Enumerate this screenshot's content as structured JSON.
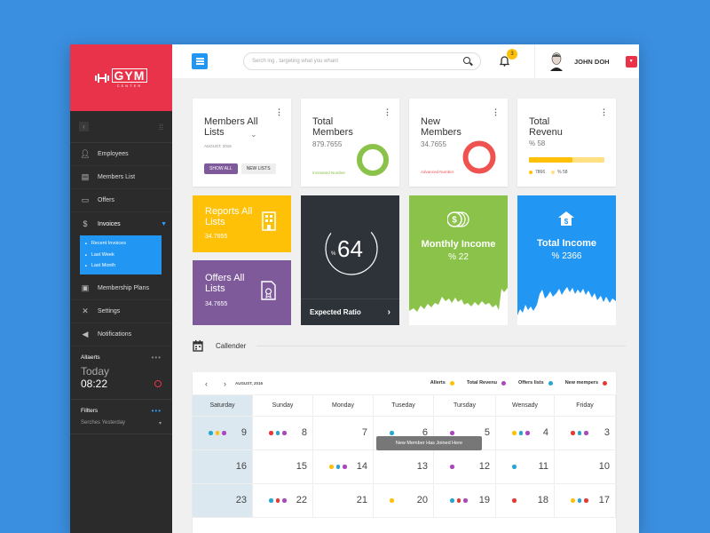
{
  "app": {
    "logo": "GYM",
    "logo_sub": "CENTER"
  },
  "sidebar": {
    "items": [
      {
        "label": "Employees",
        "icon": "user-icon"
      },
      {
        "label": "Members List",
        "icon": "users-icon"
      },
      {
        "label": "Offers",
        "icon": "monitor-icon"
      },
      {
        "label": "Invoices",
        "icon": "dollar-icon"
      },
      {
        "label": "Membership Plans",
        "icon": "card-icon"
      },
      {
        "label": "Settings",
        "icon": "tools-icon"
      },
      {
        "label": "Notifications",
        "icon": "megaphone-icon"
      }
    ],
    "submenu": [
      "Recent Invoices",
      "Last Week",
      "Last Month"
    ],
    "alerts": {
      "title": "Allaerts",
      "today": "Today",
      "time": "08:22"
    },
    "filters": {
      "title": "Fillters",
      "select": "Serches Yesterday"
    }
  },
  "topbar": {
    "search_placeholder": "Serch ing , targeting what you whant",
    "notif_count": "3",
    "user_name": "JOHN DOH"
  },
  "cards": {
    "members": {
      "title": "Members All Lists",
      "date": "AUGUST, 2016",
      "btn_all": "SHOW ALL",
      "btn_new": "NEW LISTS"
    },
    "total_members": {
      "title": "Total Members",
      "value": "879.7655",
      "note": "Increased Number",
      "ring_color": "#8bc34a"
    },
    "new_members": {
      "title": "New Members",
      "value": "34.7655",
      "note": "Advanced Number",
      "ring_color": "#ef5350"
    },
    "total_revenu": {
      "title": "Total Revenu",
      "value": "% 58",
      "legend1": "7866",
      "legend2": "% 58",
      "progress": 0.58
    }
  },
  "tiles": {
    "reports": {
      "title": "Reports All Lists",
      "value": "34.7655",
      "color": "#ffc107"
    },
    "offers": {
      "title": "Offers All Lists",
      "value": "34.7655",
      "color": "#7e5a9b"
    },
    "expected": {
      "value": "64",
      "percent": "%",
      "label": "Expected Ratio",
      "color": "#2d3339"
    },
    "monthly": {
      "title": "Monthly Income",
      "value": "% 22",
      "color": "#8bc34a"
    },
    "total_income": {
      "title": "Total Income",
      "value": "% 2366",
      "color": "#2196f3"
    }
  },
  "calendar": {
    "title": "Callender",
    "month": "AUGUST, 2016",
    "legend": [
      {
        "label": "Allerts",
        "color": "#ffc107"
      },
      {
        "label": "Total Revenu",
        "color": "#ab47bc"
      },
      {
        "label": "Offers lists",
        "color": "#26a6d1"
      },
      {
        "label": "New mempers",
        "color": "#e53935"
      }
    ],
    "days": [
      "Saturday",
      "Sunday",
      "Monday",
      "Tuseday",
      "Tursday",
      "Wensady",
      "Friday"
    ],
    "tooltip": "New Member Has Joined Here",
    "weeks": [
      [
        {
          "n": "9",
          "d": [
            "#26a6d1",
            "#ffc107",
            "#ab47bc"
          ]
        },
        {
          "n": "8",
          "d": [
            "#e53935",
            "#26a6d1",
            "#ab47bc"
          ]
        },
        {
          "n": "7",
          "d": []
        },
        {
          "n": "6",
          "d": [
            "#26a6d1"
          ]
        },
        {
          "n": "5",
          "d": [
            "#ab47bc"
          ]
        },
        {
          "n": "4",
          "d": [
            "#ffc107",
            "#26a6d1",
            "#ab47bc"
          ]
        },
        {
          "n": "3",
          "d": [
            "#e53935",
            "#26a6d1",
            "#ab47bc"
          ]
        }
      ],
      [
        {
          "n": "16",
          "d": []
        },
        {
          "n": "15",
          "d": []
        },
        {
          "n": "14",
          "d": [
            "#ffc107",
            "#26a6d1",
            "#ab47bc"
          ]
        },
        {
          "n": "13",
          "d": []
        },
        {
          "n": "12",
          "d": [
            "#ab47bc"
          ]
        },
        {
          "n": "11",
          "d": [
            "#26a6d1"
          ]
        },
        {
          "n": "10",
          "d": []
        }
      ],
      [
        {
          "n": "23",
          "d": []
        },
        {
          "n": "22",
          "d": [
            "#26a6d1",
            "#e53935",
            "#ab47bc"
          ]
        },
        {
          "n": "21",
          "d": []
        },
        {
          "n": "20",
          "d": [
            "#ffc107"
          ]
        },
        {
          "n": "19",
          "d": [
            "#26a6d1",
            "#e53935",
            "#ab47bc"
          ]
        },
        {
          "n": "18",
          "d": [
            "#e53935"
          ]
        },
        {
          "n": "17",
          "d": [
            "#ffc107",
            "#26a6d1",
            "#e53935"
          ]
        }
      ]
    ]
  }
}
